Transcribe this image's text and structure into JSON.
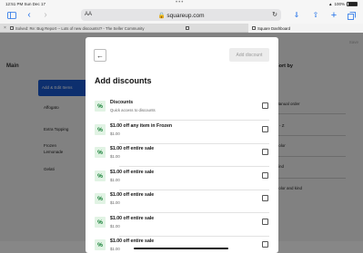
{
  "status_bar": {
    "time": "12:51 PM",
    "date": "Sun Dec 17",
    "battery": "100%"
  },
  "browser": {
    "text_size_label": "AA",
    "url": "squareup.com",
    "icons": [
      "sidebar-icon",
      "back-icon",
      "forward-icon",
      "reload-icon",
      "download-icon",
      "share-icon",
      "new-tab-icon",
      "tab-overview-icon"
    ],
    "tabs": [
      {
        "label": "Solved: Re: Bug Report -- Lots of new discounts!? - The Seller Community",
        "active": false
      },
      {
        "label": "",
        "active": false
      },
      {
        "label": "Square Dashboard",
        "active": true
      }
    ]
  },
  "background": {
    "main_label": "Main",
    "add_button_label": "Add & Edit Items",
    "items": [
      "Affogato",
      "Extra Topping",
      "Frozen",
      "Lemonade",
      "Gelati"
    ],
    "right_heading": "Sort by",
    "right_items": [
      "Manual order",
      "A - Z",
      "Color",
      "Kind",
      "Color and kind"
    ],
    "save_label": "Save"
  },
  "modal": {
    "back_label": "←",
    "add_discount_label": "Add discount",
    "title": "Add discounts",
    "rows": [
      {
        "title": "Discounts",
        "subtitle": "Quick access to discounts",
        "icon": "percent-icon",
        "checked": false
      },
      {
        "title": "$1.00 off any item in Frozen",
        "subtitle": "$1.00",
        "icon": "percent-icon",
        "checked": false
      },
      {
        "title": "$1.00 off entire sale",
        "subtitle": "$1.00",
        "icon": "percent-icon",
        "checked": false
      },
      {
        "title": "$1.00 off entire sale",
        "subtitle": "$1.00",
        "icon": "percent-icon",
        "checked": false
      },
      {
        "title": "$1.00 off entire sale",
        "subtitle": "$1.00",
        "icon": "percent-icon",
        "checked": false
      },
      {
        "title": "$1.00 off entire sale",
        "subtitle": "$1.00",
        "icon": "percent-icon",
        "checked": false
      },
      {
        "title": "$1.00 off entire sale",
        "subtitle": "$1.00",
        "icon": "percent-icon",
        "checked": false
      }
    ],
    "icon_glyph": "%"
  },
  "colors": {
    "accent": "#1f6fe8",
    "discount_icon_bg": "#e1f3e4",
    "discount_icon_fg": "#0c7a2d",
    "overlay": "rgba(0,0,0,0.47)"
  }
}
